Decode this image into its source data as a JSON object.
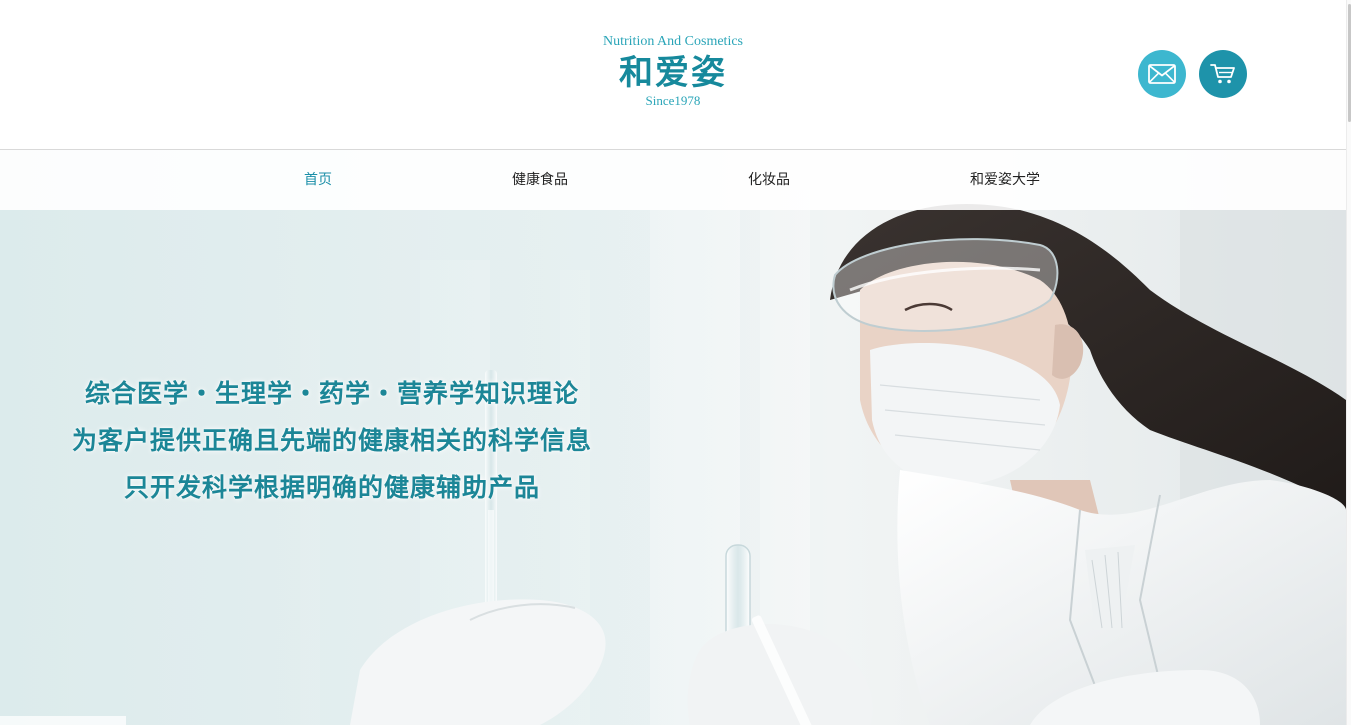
{
  "brand": {
    "name_en": "Nutrition And Cosmetics",
    "name_cn": "和爱姿",
    "since": "Since1978"
  },
  "header_actions": {
    "mail_icon": "envelope-icon",
    "cart_icon": "shopping-cart-icon"
  },
  "nav": {
    "items": [
      {
        "label": "首页",
        "active": true
      },
      {
        "label": "健康食品",
        "active": false
      },
      {
        "label": "化妆品",
        "active": false
      },
      {
        "label": "和爱姿大学",
        "active": false
      }
    ]
  },
  "hero": {
    "slogans": [
      "综合医学・生理学・药学・营养学知识理论",
      "为客户提供正确且先端的健康相关的科学信息",
      "只开发科学根据明确的健康辅助产品"
    ]
  },
  "colors": {
    "brand_teal": "#16899c",
    "accent_light": "#3db7cf",
    "accent_dark": "#1e93aa",
    "nav_active": "#1b8fa8",
    "text_dark": "#222222"
  }
}
